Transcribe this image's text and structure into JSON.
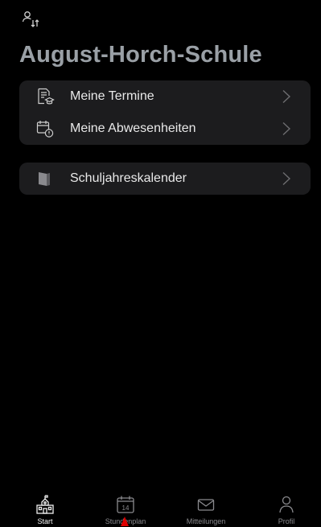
{
  "header": {
    "account_switch_icon": "person-switch-icon",
    "school_name": "August-Horch-Schule"
  },
  "menu": {
    "group1": [
      {
        "label": "Meine Termine",
        "icon": "document-graduation-icon"
      },
      {
        "label": "Meine Abwesenheiten",
        "icon": "calendar-absence-icon"
      }
    ],
    "group2": [
      {
        "label": "Schuljahreskalender",
        "icon": "calendar-book-icon"
      }
    ]
  },
  "tabbar": {
    "tabs": [
      {
        "label": "Start",
        "icon": "school-icon",
        "active": true
      },
      {
        "label": "Stundenplan",
        "icon": "calendar-day-icon",
        "day": "14",
        "active": false
      },
      {
        "label": "Mitteilungen",
        "icon": "envelope-icon",
        "active": false
      },
      {
        "label": "Profil",
        "icon": "person-icon",
        "active": false
      }
    ]
  },
  "colors": {
    "background": "#000000",
    "card": "#1c1c1e",
    "title": "#9aa0a6",
    "tab_inactive": "#8a8a8e"
  }
}
